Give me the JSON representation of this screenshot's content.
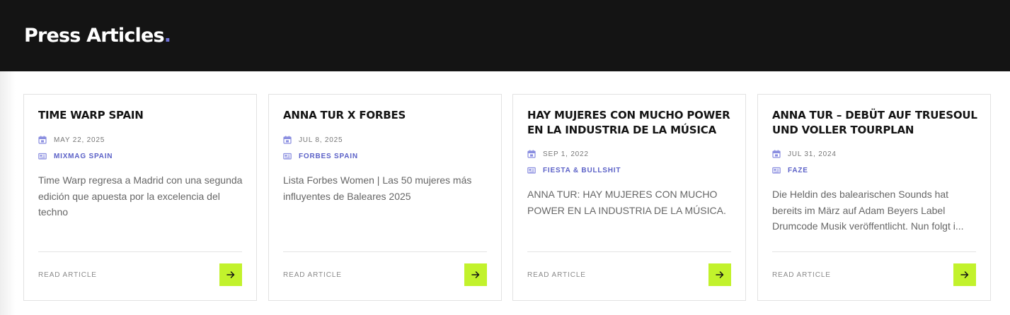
{
  "header": {
    "title": "Press Articles",
    "title_dot": "."
  },
  "labels": {
    "read_article": "READ ARTICLE"
  },
  "colors": {
    "header_bg": "#141414",
    "accent_dot": "#6f73d9",
    "source_text": "#5b61c7",
    "icon_color": "#8a8ee0",
    "button_bg": "#c2f22c"
  },
  "icons": {
    "date": "calendar-icon",
    "source": "newspaper-icon",
    "button": "arrow-right-icon"
  },
  "articles": [
    {
      "title": "TIME WARP SPAIN",
      "date": "MAY 22, 2025",
      "source": "MIXMAG SPAIN",
      "excerpt": "Time Warp regresa a Madrid con una segunda edición que apuesta por la excelencia del techno"
    },
    {
      "title": "ANNA TUR X FORBES",
      "date": "JUL 8, 2025",
      "source": "FORBES SPAIN",
      "excerpt": "Lista Forbes Women | Las 50 mujeres más influyentes de Baleares 2025"
    },
    {
      "title": "HAY MUJERES CON MUCHO POWER EN LA INDUSTRIA DE LA MÚSICA",
      "date": "SEP 1, 2022",
      "source": "FIESTA & BULLSHIT",
      "excerpt": "ANNA TUR: HAY MUJERES CON MUCHO POWER EN LA INDUSTRIA DE LA MÚSICA."
    },
    {
      "title": "ANNA TUR – DEBÜT AUF TRUESOUL UND VOLLER TOURPLAN",
      "date": "JUL 31, 2024",
      "source": "FAZE",
      "excerpt": "Die Heldin des balearischen Sounds hat bereits im März auf Adam Beyers Label Drumcode Musik veröffentlicht. Nun folgt i..."
    }
  ]
}
